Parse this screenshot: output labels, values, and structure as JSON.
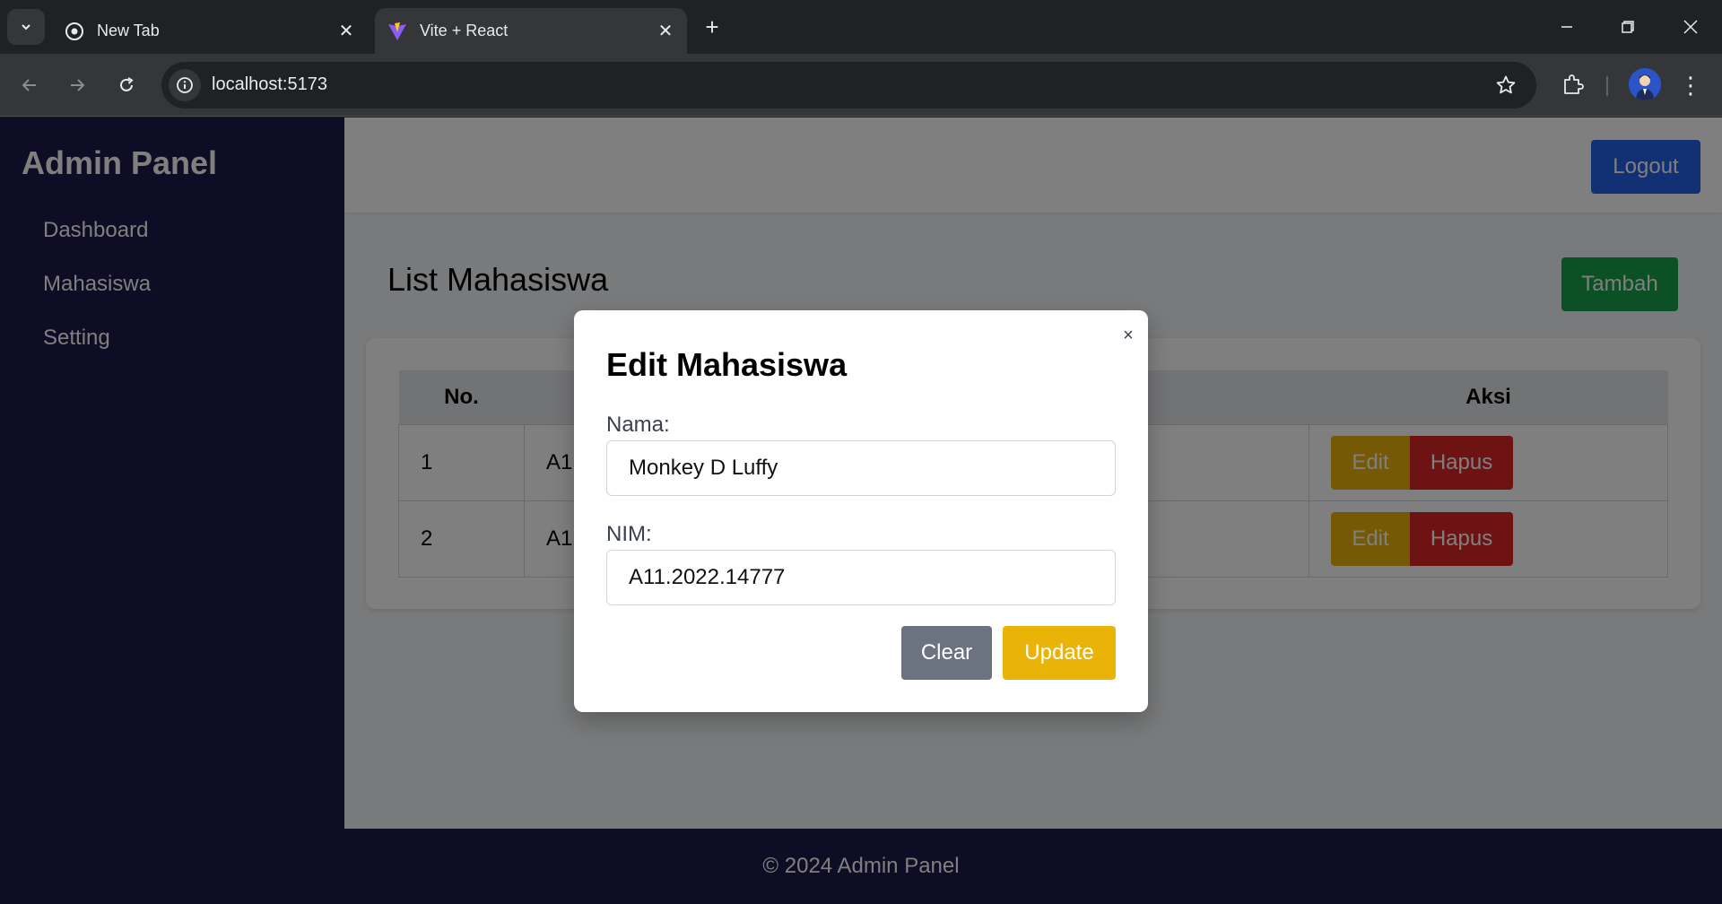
{
  "browser": {
    "tabs": [
      {
        "title": "New Tab",
        "favicon": "chrome-icon"
      },
      {
        "title": "Vite + React",
        "favicon": "vite-icon"
      }
    ],
    "url": "localhost:5173"
  },
  "app": {
    "brand": "Admin Panel",
    "sidebar": {
      "items": [
        {
          "label": "Dashboard"
        },
        {
          "label": "Mahasiswa"
        },
        {
          "label": "Setting"
        }
      ]
    },
    "header": {
      "logout_label": "Logout"
    },
    "main": {
      "title": "List Mahasiswa",
      "add_label": "Tambah",
      "table": {
        "headers": [
          "No.",
          "",
          "",
          "Aksi"
        ],
        "rows": [
          {
            "no": "1",
            "nim": "A1"
          },
          {
            "no": "2",
            "nim": "A1"
          }
        ],
        "edit_label": "Edit",
        "delete_label": "Hapus"
      }
    },
    "footer": {
      "text": "© 2024 Admin Panel"
    },
    "modal": {
      "title": "Edit Mahasiswa",
      "close_symbol": "×",
      "nama_label": "Nama:",
      "nama_value": "Monkey D Luffy",
      "nim_label": "NIM:",
      "nim_value": "A11.2022.14777",
      "clear_label": "Clear",
      "update_label": "Update"
    }
  },
  "colors": {
    "sidebar": "#1e1b4b",
    "logout": "#2563eb",
    "tambah": "#16a34a",
    "edit": "#eab308",
    "hapus": "#dc2626",
    "clear": "#6b7280",
    "update": "#eab308"
  }
}
